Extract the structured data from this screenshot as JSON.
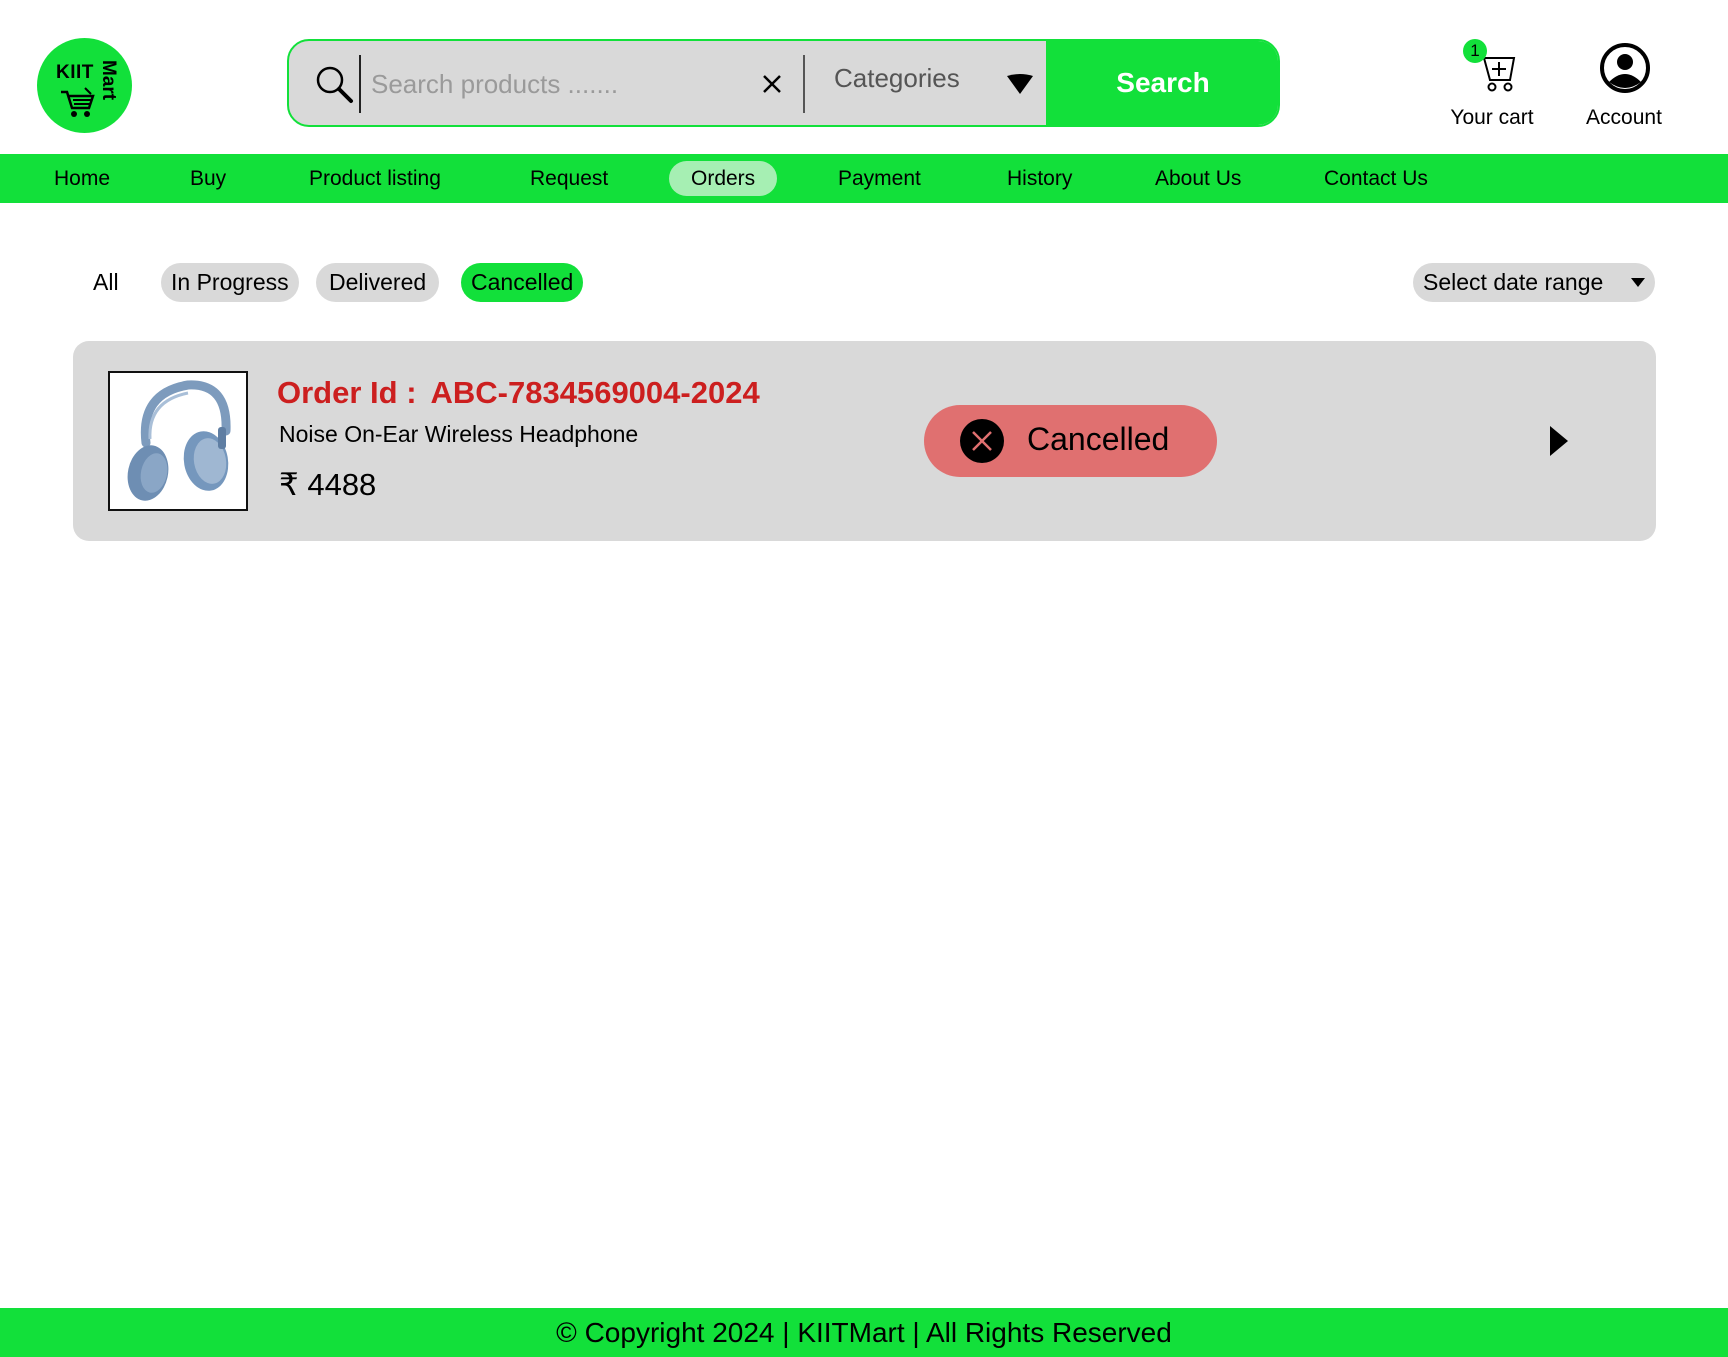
{
  "brand": {
    "logo_line1": "KIIT",
    "logo_line2": "Mart"
  },
  "search": {
    "placeholder": "Search products .......",
    "categories_label": "Categories",
    "button_label": "Search"
  },
  "cart": {
    "count": "1",
    "label": "Your cart"
  },
  "account": {
    "label": "Account"
  },
  "nav": {
    "items": [
      {
        "label": "Home"
      },
      {
        "label": "Buy"
      },
      {
        "label": "Product listing"
      },
      {
        "label": "Request"
      },
      {
        "label": "Orders",
        "active": true
      },
      {
        "label": "Payment"
      },
      {
        "label": "History"
      },
      {
        "label": "About Us"
      },
      {
        "label": "Contact Us"
      }
    ]
  },
  "filters": {
    "items": [
      {
        "label": "All"
      },
      {
        "label": "In Progress"
      },
      {
        "label": "Delivered"
      },
      {
        "label": "Cancelled",
        "active": true
      }
    ],
    "date_range_label": "Select date range"
  },
  "orders": [
    {
      "id_label": "Order Id :",
      "id_value": "ABC-7834569004-2024",
      "product_name": "Noise On-Ear Wireless Headphone",
      "price": "₹ 4488",
      "status": "Cancelled",
      "status_icon": "close-circle-icon",
      "image": "headphone-thumbnail"
    }
  ],
  "footer": {
    "text": "© Copyright 2024 | KIITMart | All Rights Reserved"
  },
  "colors": {
    "accent": "#12e03a",
    "nav_active": "#a6efb3",
    "order_id": "#cc1f1f",
    "cancelled_badge": "#e07070",
    "card_bg": "#d9d9d9"
  }
}
